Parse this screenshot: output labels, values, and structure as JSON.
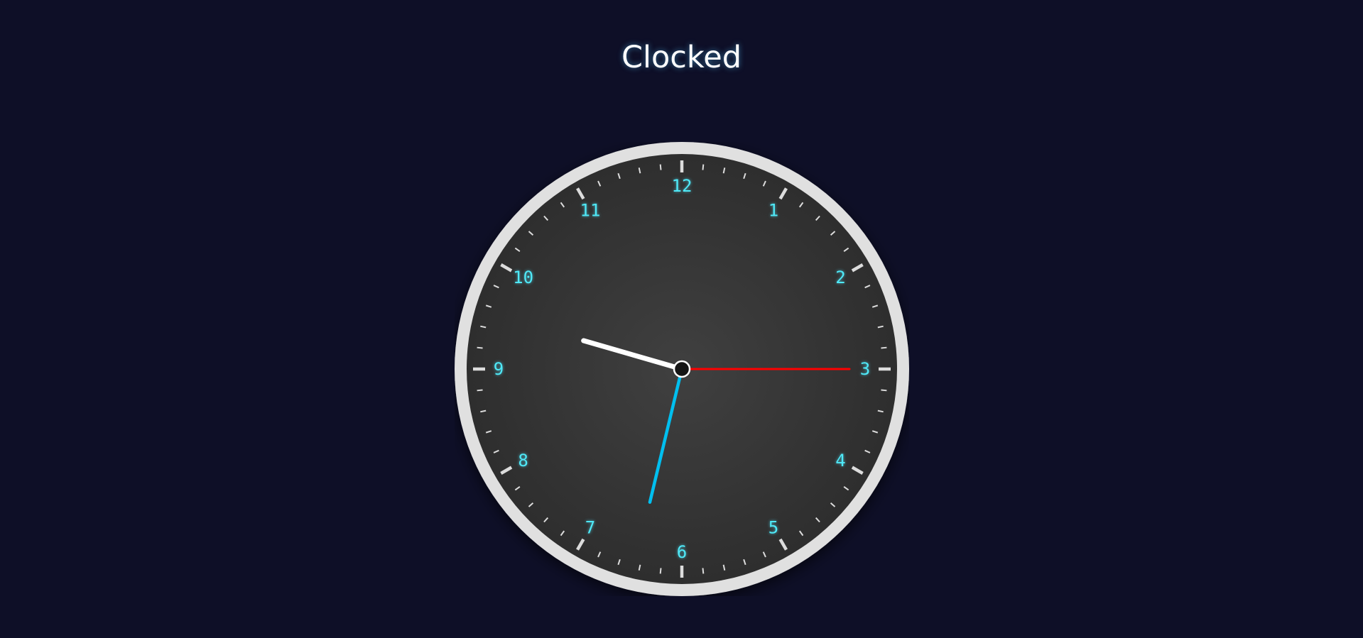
{
  "header": {
    "title": "Clocked"
  },
  "clock": {
    "numerals": [
      "12",
      "1",
      "2",
      "3",
      "4",
      "5",
      "6",
      "7",
      "8",
      "9",
      "10",
      "11"
    ],
    "time": {
      "hours": 9,
      "minutes": 32,
      "seconds": 15
    },
    "colors": {
      "background": "#0e0f27",
      "ring": "#e0e0e0",
      "face": "#363636",
      "numerals": "#4fe9f7",
      "hour_hand": "#ffffff",
      "minute_hand": "#00bfef",
      "second_hand": "#ff0000",
      "ticks": "#dcdcdc"
    }
  }
}
